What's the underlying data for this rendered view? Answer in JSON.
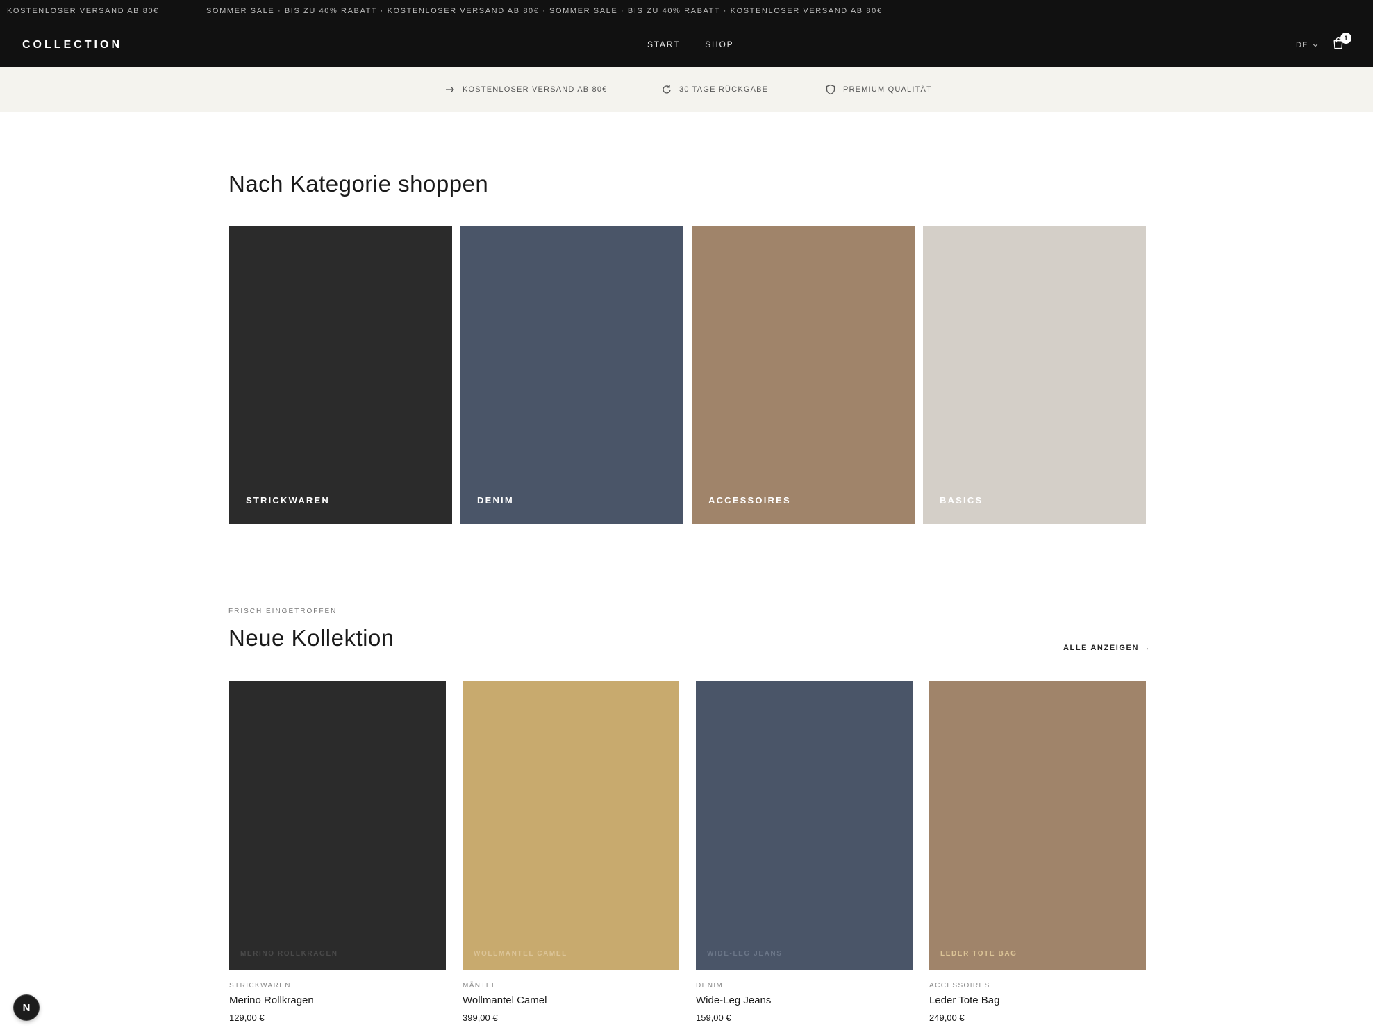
{
  "announcement": {
    "text_1": "KOSTENLOSER VERSAND AB 80€",
    "text_2": "SOMMER SALE · BIS ZU 40% RABATT · KOSTENLOSER VERSAND AB 80€ · SOMMER SALE · BIS ZU 40% RABATT · KOSTENLOSER VERSAND AB 80€"
  },
  "header": {
    "logo": "COLLECTION",
    "nav": [
      "START",
      "SHOP"
    ],
    "language": "DE",
    "cart_count": "1",
    "icons": {
      "language": "chevron-down-icon",
      "cart": "shopping-bag-icon"
    }
  },
  "usp": [
    {
      "icon": "arrow-right-icon",
      "label": "KOSTENLOSER VERSAND AB 80€"
    },
    {
      "icon": "refresh-icon",
      "label": "30 TAGE RÜCKGABE"
    },
    {
      "icon": "shield-icon",
      "label": "PREMIUM QUALITÄT"
    }
  ],
  "categories": {
    "heading": "Nach Kategorie shoppen",
    "items": [
      {
        "label": "STRICKWAREN",
        "color": "#2b2b2b"
      },
      {
        "label": "DENIM",
        "color": "#4a5568"
      },
      {
        "label": "ACCESSOIRES",
        "color": "#a0846a"
      },
      {
        "label": "BASICS",
        "color": "#d4cfc8"
      }
    ]
  },
  "new_collection": {
    "eyebrow": "FRISCH EINGETROFFEN",
    "heading": "Neue Kollektion",
    "see_all": "ALLE ANZEIGEN →",
    "products": [
      {
        "overlay": "MERINO ROLLKRAGEN",
        "category": "STRICKWAREN",
        "name": "Merino Rollkragen",
        "price": "129,00 €",
        "color": "#2b2b2b",
        "overlay_color": "#4a4a4a"
      },
      {
        "overlay": "WOLLMANTEL CAMEL",
        "category": "MÄNTEL",
        "name": "Wollmantel Camel",
        "price": "399,00 €",
        "color": "#c8aa6e",
        "overlay_color": "#dcc497"
      },
      {
        "overlay": "WIDE-LEG JEANS",
        "category": "DENIM",
        "name": "Wide-Leg Jeans",
        "price": "159,00 €",
        "color": "#4a5568",
        "overlay_color": "#6b7688"
      },
      {
        "overlay": "LEDER TOTE BAG",
        "category": "ACCESSOIRES",
        "name": "Leder Tote Bag",
        "price": "249,00 €",
        "color": "#a0846a",
        "overlay_color": "#dcc497"
      }
    ]
  },
  "floating_badge": {
    "letter": "N"
  }
}
